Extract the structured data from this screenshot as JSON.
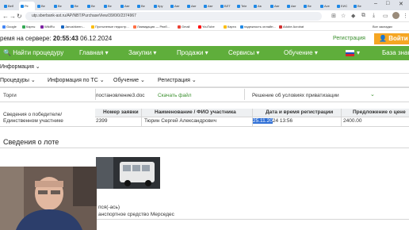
{
  "browser": {
    "tabs": [
      "Веб",
      "Ре",
      "Ве",
      "Ве",
      "Ве",
      "Ве",
      "Ве",
      "Авт",
      "Ве",
      "Кру",
      "Авт",
      "Авт",
      "Авт",
      "ВЛТ",
      "Tele",
      "Ав",
      "Авт",
      "Авт",
      "Ве",
      "Ave",
      "ЕИС",
      "Ве"
    ],
    "url": "utp.sberbank-ast.ru/AP/NBT/PurchaseView/39/0/0/2374967",
    "bookmarks": [
      "Google",
      "Карты",
      "WildRu",
      "Janushkeen...",
      "Пустыненые недостр...",
      "Ликвидация — Реиб...",
      "Gmail",
      "YouTube",
      "Карта",
      "надежность онлайн...",
      "Adobe Acrobat"
    ],
    "bookmarks_right": "Все закладки"
  },
  "header": {
    "server_label": "ремя на сервере:",
    "server_time": "20:55:43",
    "server_date": "06.12.2024",
    "register": "Регистрация",
    "login": "Войти"
  },
  "nav": {
    "find": "Найти процедуру",
    "items": [
      "Главная",
      "Закупки",
      "Продажи",
      "Сервисы",
      "Обучение",
      "База знан"
    ]
  },
  "subnav1": [
    "Информация"
  ],
  "subnav2": [
    "Процедуры",
    "Информация по ТС",
    "Обучение",
    "Регистрация"
  ],
  "content": {
    "torgi_label": "Торги",
    "torgi_doc": "постановление3.doc",
    "download": "Скачать файл",
    "decision": "Решение об условиях приватизации",
    "winner_label_1": "Сведения о победителе/",
    "winner_label_2": "Единственном участнике",
    "table_headers": [
      "Номер заявки",
      "Наименование / ФИО участника",
      "Дата и время регистрации",
      "Предложение о цене"
    ],
    "row": {
      "number": "2399",
      "name": "Тюрин Сергей Александрович",
      "date_highlight": "25.11.20",
      "date_rest": "24 13:56",
      "price": "2400.00"
    },
    "lot_title": "Сведения о лоте",
    "lot_line1": "пся(-ась)",
    "lot_line2": "анспортное средство Мерседес"
  },
  "colors": {
    "nav_green": "#5fae3b",
    "login_orange": "#f5a623",
    "link_green": "#3a8f2d",
    "selection_blue": "#2f6fd6"
  }
}
